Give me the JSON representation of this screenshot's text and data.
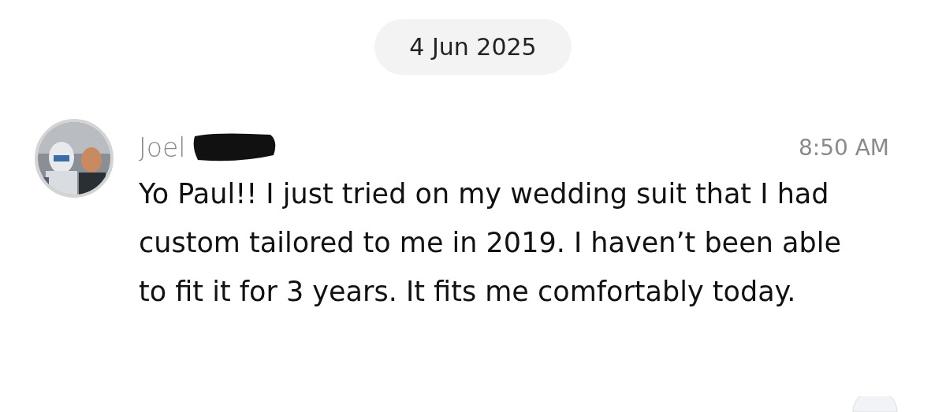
{
  "date_divider": "4 Jun 2025",
  "message": {
    "sender": "Joel",
    "time": "8:50 AM",
    "redacted": true,
    "text": "Yo Paul!! I just tried on my wedding suit that I had custom tailored to me in 2019. I haven’t been able to fit it for 3 years. It fits me comfortably today."
  }
}
